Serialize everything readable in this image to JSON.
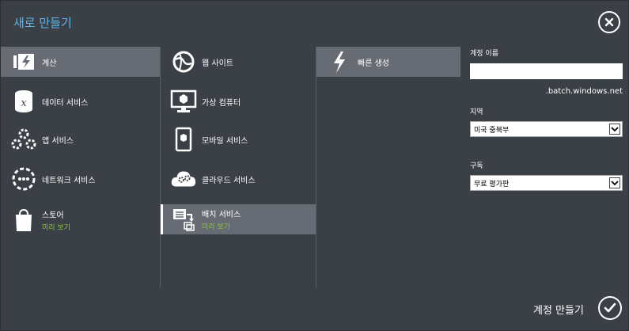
{
  "dialog": {
    "title": "새로 만들기",
    "create_label": "계정 만들기"
  },
  "col1": [
    {
      "label": "계산",
      "icon": "compute-icon",
      "selected": true
    },
    {
      "label": "데이터 서비스",
      "icon": "data-services-icon"
    },
    {
      "label": "앱 서비스",
      "icon": "app-services-icon"
    },
    {
      "label": "네트워크 서비스",
      "icon": "network-services-icon"
    },
    {
      "label": "스토어",
      "sub": "미리 보기",
      "icon": "store-icon"
    }
  ],
  "col2": [
    {
      "label": "웹 사이트",
      "icon": "website-icon"
    },
    {
      "label": "가상 컴퓨터",
      "icon": "virtual-machine-icon"
    },
    {
      "label": "모바일 서비스",
      "icon": "mobile-services-icon"
    },
    {
      "label": "클라우드 서비스",
      "icon": "cloud-services-icon"
    },
    {
      "label": "배치 서비스",
      "sub": "미리 보기",
      "icon": "batch-services-icon",
      "selected": true
    }
  ],
  "col3": [
    {
      "label": "빠른 생성",
      "icon": "quick-create-icon",
      "selected": true
    }
  ],
  "form": {
    "account_name_label": "계정 이름",
    "account_name_value": "",
    "account_name_suffix": ".batch.windows.net",
    "region_label": "지역",
    "region_value": "미국 중북부",
    "subscription_label": "구독",
    "subscription_value": "무료 평가판"
  },
  "colors": {
    "title": "#5fb4e8",
    "preview": "#8ec63f",
    "background": "#3b3f46",
    "selected": "#676b73"
  }
}
